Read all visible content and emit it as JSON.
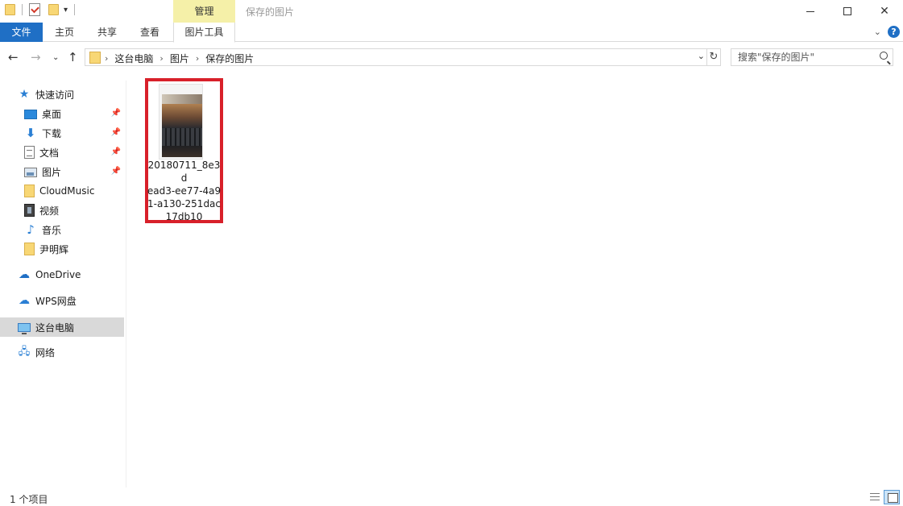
{
  "window": {
    "title": "保存的图片",
    "context_tab": "管理"
  },
  "ribbon": {
    "tabs": [
      {
        "label": "文件",
        "type": "file"
      },
      {
        "label": "主页"
      },
      {
        "label": "共享"
      },
      {
        "label": "查看"
      },
      {
        "label": "图片工具",
        "active": true
      }
    ]
  },
  "address": {
    "crumbs": [
      "这台电脑",
      "图片",
      "保存的图片"
    ]
  },
  "search": {
    "placeholder": "搜索\"保存的图片\""
  },
  "sidebar": {
    "items": [
      {
        "label": "快速访问",
        "icon": "star-icon",
        "indent": 0
      },
      {
        "label": "桌面",
        "icon": "desktop-icon",
        "indent": 1,
        "pinned": true
      },
      {
        "label": "下载",
        "icon": "download-icon",
        "indent": 1,
        "pinned": true
      },
      {
        "label": "文档",
        "icon": "document-icon",
        "indent": 1,
        "pinned": true
      },
      {
        "label": "图片",
        "icon": "pictures-icon",
        "indent": 1,
        "pinned": true
      },
      {
        "label": "CloudMusic",
        "icon": "folder-icon",
        "indent": 1
      },
      {
        "label": "视频",
        "icon": "video-icon",
        "indent": 1
      },
      {
        "label": "音乐",
        "icon": "music-icon",
        "indent": 1
      },
      {
        "label": "尹明辉",
        "icon": "folder-icon",
        "indent": 1
      },
      {
        "label": "OneDrive",
        "icon": "onedrive-icon",
        "indent": 0
      },
      {
        "label": "WPS网盘",
        "icon": "wps-cloud-icon",
        "indent": 0
      },
      {
        "label": "这台电脑",
        "icon": "this-pc-icon",
        "indent": 0,
        "selected": true
      },
      {
        "label": "网络",
        "icon": "network-icon",
        "indent": 0
      }
    ]
  },
  "files": [
    {
      "name_lines": [
        "20180711_8e3d",
        "ead3-ee77-4a9",
        "1-a130-251dac",
        "17db10"
      ],
      "highlighted": true
    }
  ],
  "status": {
    "item_count": "1 个项目"
  },
  "colors": {
    "accent": "#1f6fc5",
    "manage_tab": "#f5f0a8",
    "highlight_border": "#d8202a",
    "selected_nav": "#d9d9d9"
  }
}
